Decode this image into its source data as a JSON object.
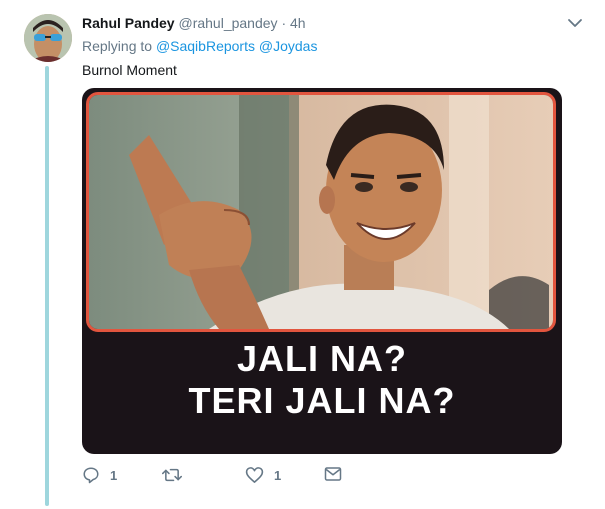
{
  "tweet": {
    "display_name": "Rahul Pandey",
    "handle": "@rahul_pandey",
    "separator": "·",
    "time": "4h",
    "replying_prefix": "Replying to",
    "replying_to": [
      "@SaqibReports",
      "@Joydas"
    ],
    "text": "Burnol Moment"
  },
  "media": {
    "caption_line1": "JALI NA?",
    "caption_line2": "TERI JALI NA?"
  },
  "actions": {
    "reply_count": "1",
    "retweet_count": "",
    "like_count": "1"
  },
  "colors": {
    "thread_line": "#9ed6dd",
    "link": "#1b95e0",
    "meta_gray": "#657786",
    "frame_border": "#e2553e",
    "caption_bg": "#1a1318"
  }
}
